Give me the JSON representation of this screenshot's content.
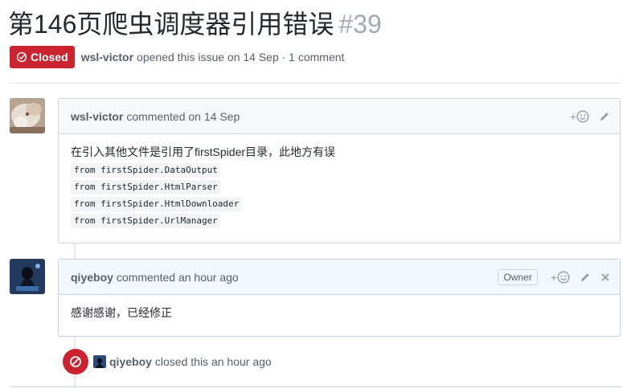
{
  "issue": {
    "title": "第146页爬虫调度器引用错误",
    "number": "#39",
    "state_label": "Closed",
    "author": "wsl-victor",
    "opened_text": "opened this issue on 14 Sep · 1 comment"
  },
  "comments": [
    {
      "author": "wsl-victor",
      "meta": "commented on 14 Sep",
      "body_text": "在引入其他文件是引用了firstSpider目录，此地方有误",
      "code_lines": [
        "from firstSpider.DataOutput",
        "from firstSpider.HtmlParser",
        "from firstSpider.HtmlDownloader",
        "from firstSpider.UrlManager"
      ],
      "reaction_label": "+"
    },
    {
      "author": "qiyeboy",
      "meta": "commented an hour ago",
      "role_label": "Owner",
      "body_text": "感谢感谢，已经修正",
      "reaction_label": "+"
    }
  ],
  "event": {
    "actor": "qiyeboy",
    "text": "closed this an hour ago"
  },
  "colors": {
    "closed_red": "#cb2431",
    "owner_header_bg": "#f1f8ff",
    "header_bg": "#f6f8fa"
  },
  "icons": [
    "issue-closed-icon",
    "smiley-icon",
    "pencil-icon",
    "close-icon",
    "circle-slash-icon"
  ]
}
